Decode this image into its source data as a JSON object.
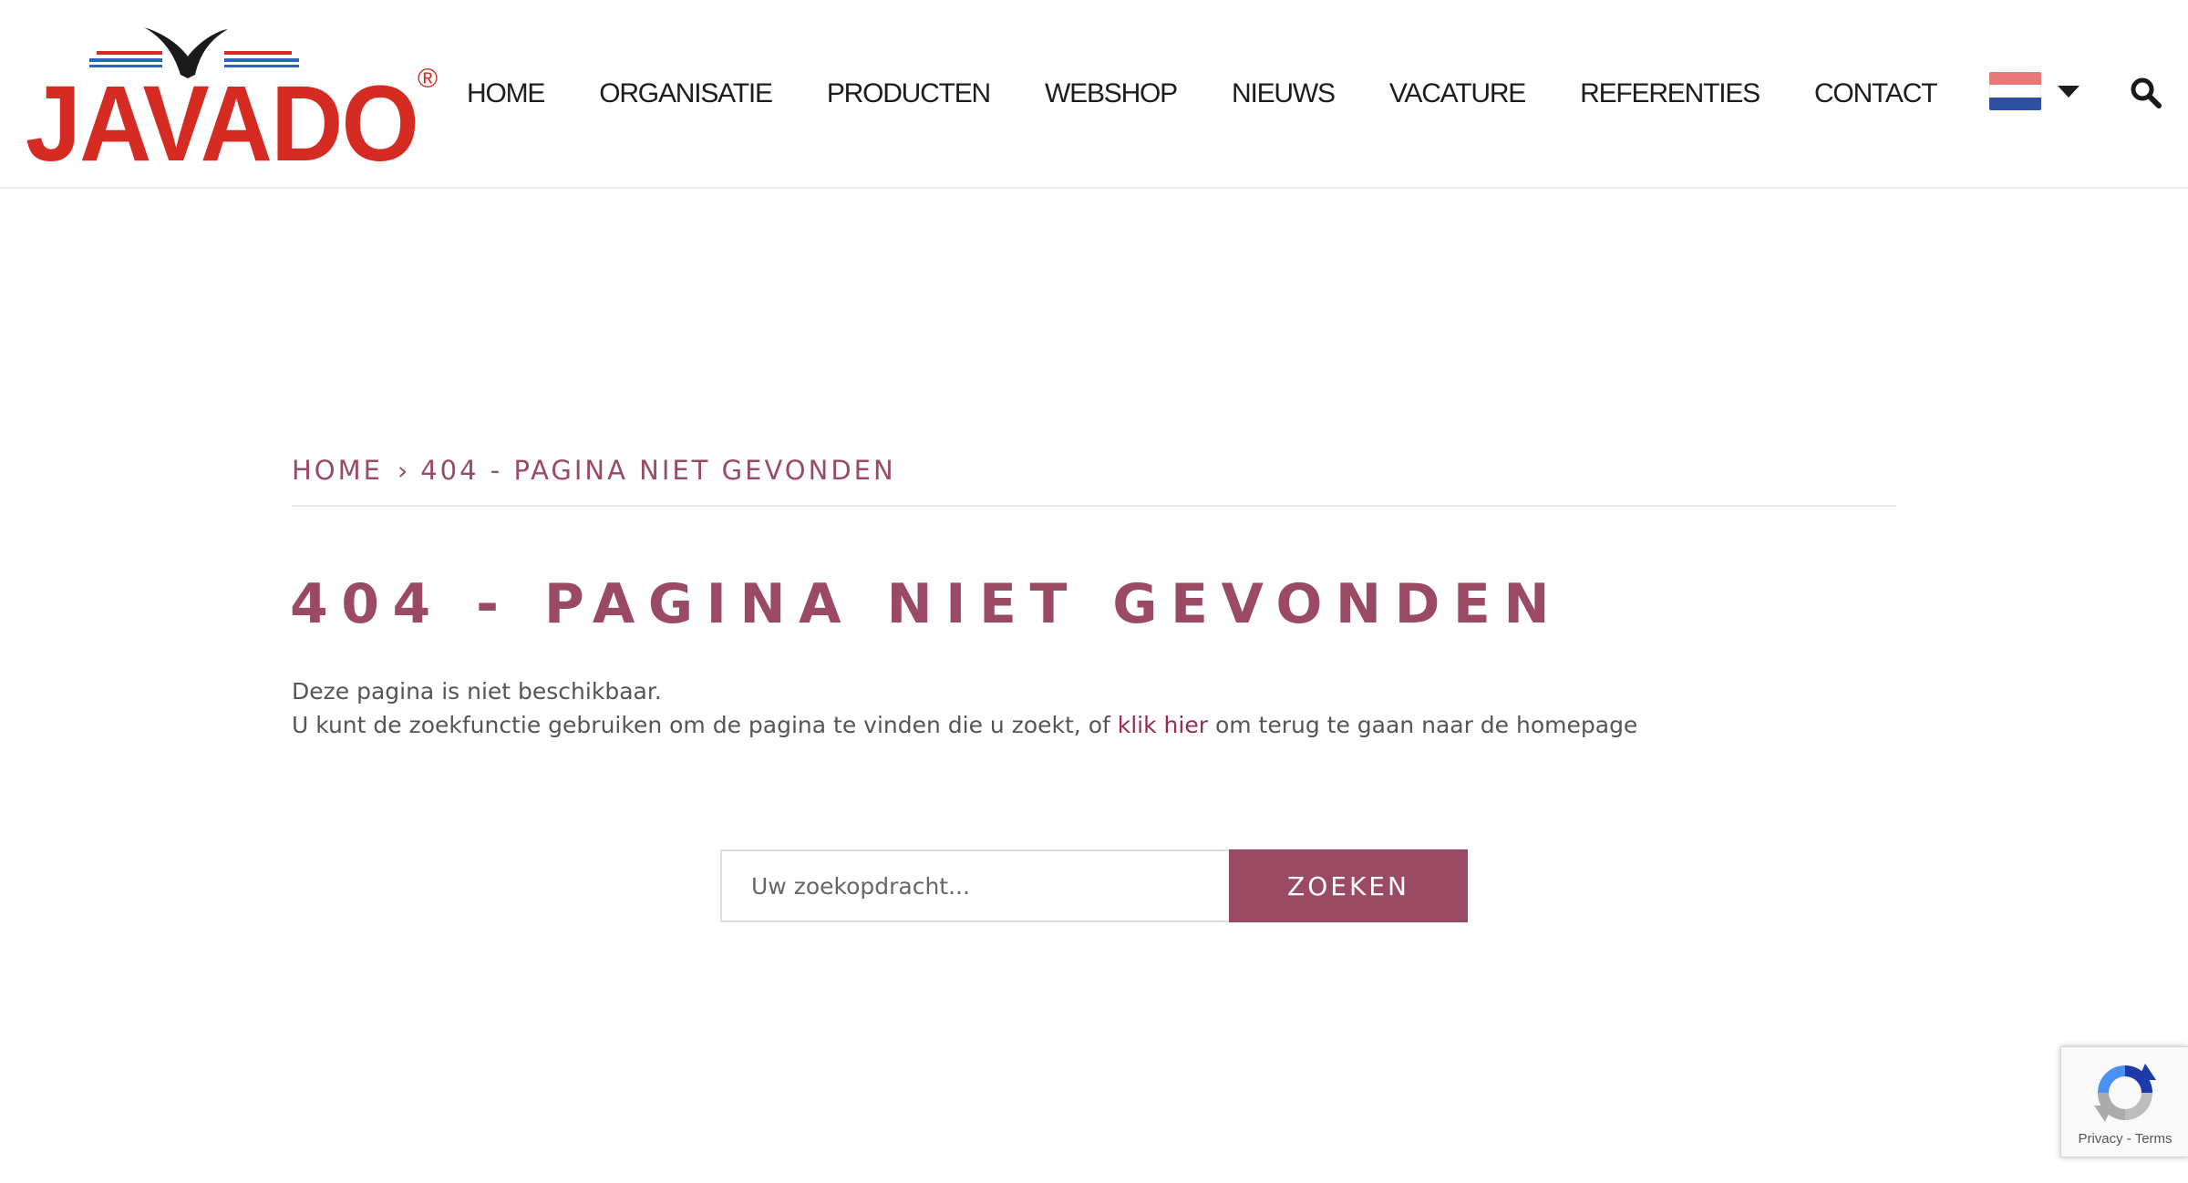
{
  "brand": {
    "logo_text": "JAVADO",
    "registered_mark": "®",
    "colors": {
      "red": "#d52b23",
      "blue": "#2a66b5",
      "black": "#1a1a1a"
    }
  },
  "nav": {
    "items": [
      {
        "label": "HOME"
      },
      {
        "label": "ORGANISATIE"
      },
      {
        "label": "PRODUCTEN"
      },
      {
        "label": "WEBSHOP"
      },
      {
        "label": "NIEUWS"
      },
      {
        "label": "VACATURE"
      },
      {
        "label": "REFERENTIES"
      },
      {
        "label": "CONTACT"
      }
    ],
    "language": {
      "flag": "netherlands-flag",
      "flag_colors": [
        "#e8797a",
        "#ffffff",
        "#2f4fa0"
      ]
    },
    "search_icon": "search-icon"
  },
  "breadcrumb": {
    "home": "HOME",
    "separator": "›",
    "current": "404 - PAGINA NIET GEVONDEN"
  },
  "page": {
    "title": "404 - PAGINA NIET GEVONDEN",
    "line1": "Deze pagina is niet beschikbaar.",
    "line2_before": "U kunt de zoekfunctie gebruiken om de pagina te vinden die u zoekt, of ",
    "line2_link": "klik hier",
    "line2_after": " om terug te gaan naar de homepage",
    "accent_color": "#9b4a63"
  },
  "search": {
    "placeholder": "Uw zoekopdracht...",
    "value": "",
    "button_label": "ZOEKEN"
  },
  "recaptcha": {
    "privacy": "Privacy",
    "separator": " - ",
    "terms": "Terms"
  }
}
